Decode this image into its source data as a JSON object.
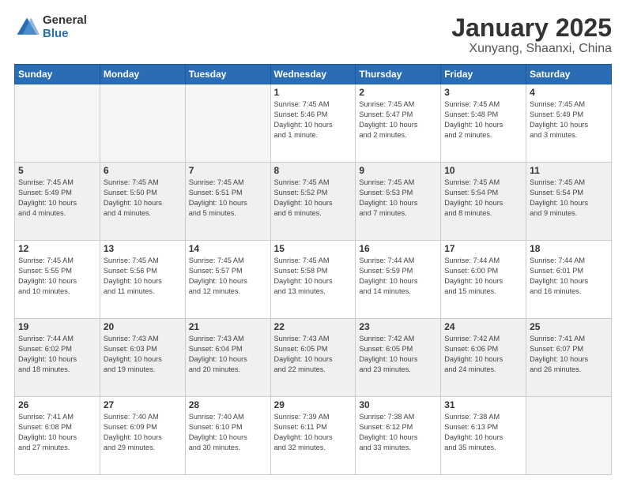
{
  "logo": {
    "general": "General",
    "blue": "Blue"
  },
  "title": "January 2025",
  "subtitle": "Xunyang, Shaanxi, China",
  "weekdays": [
    "Sunday",
    "Monday",
    "Tuesday",
    "Wednesday",
    "Thursday",
    "Friday",
    "Saturday"
  ],
  "weeks": [
    {
      "shaded": false,
      "days": [
        {
          "num": "",
          "info": "",
          "empty": true
        },
        {
          "num": "",
          "info": "",
          "empty": true
        },
        {
          "num": "",
          "info": "",
          "empty": true
        },
        {
          "num": "1",
          "info": "Sunrise: 7:45 AM\nSunset: 5:46 PM\nDaylight: 10 hours\nand 1 minute.",
          "empty": false
        },
        {
          "num": "2",
          "info": "Sunrise: 7:45 AM\nSunset: 5:47 PM\nDaylight: 10 hours\nand 2 minutes.",
          "empty": false
        },
        {
          "num": "3",
          "info": "Sunrise: 7:45 AM\nSunset: 5:48 PM\nDaylight: 10 hours\nand 2 minutes.",
          "empty": false
        },
        {
          "num": "4",
          "info": "Sunrise: 7:45 AM\nSunset: 5:49 PM\nDaylight: 10 hours\nand 3 minutes.",
          "empty": false
        }
      ]
    },
    {
      "shaded": true,
      "days": [
        {
          "num": "5",
          "info": "Sunrise: 7:45 AM\nSunset: 5:49 PM\nDaylight: 10 hours\nand 4 minutes.",
          "empty": false
        },
        {
          "num": "6",
          "info": "Sunrise: 7:45 AM\nSunset: 5:50 PM\nDaylight: 10 hours\nand 4 minutes.",
          "empty": false
        },
        {
          "num": "7",
          "info": "Sunrise: 7:45 AM\nSunset: 5:51 PM\nDaylight: 10 hours\nand 5 minutes.",
          "empty": false
        },
        {
          "num": "8",
          "info": "Sunrise: 7:45 AM\nSunset: 5:52 PM\nDaylight: 10 hours\nand 6 minutes.",
          "empty": false
        },
        {
          "num": "9",
          "info": "Sunrise: 7:45 AM\nSunset: 5:53 PM\nDaylight: 10 hours\nand 7 minutes.",
          "empty": false
        },
        {
          "num": "10",
          "info": "Sunrise: 7:45 AM\nSunset: 5:54 PM\nDaylight: 10 hours\nand 8 minutes.",
          "empty": false
        },
        {
          "num": "11",
          "info": "Sunrise: 7:45 AM\nSunset: 5:54 PM\nDaylight: 10 hours\nand 9 minutes.",
          "empty": false
        }
      ]
    },
    {
      "shaded": false,
      "days": [
        {
          "num": "12",
          "info": "Sunrise: 7:45 AM\nSunset: 5:55 PM\nDaylight: 10 hours\nand 10 minutes.",
          "empty": false
        },
        {
          "num": "13",
          "info": "Sunrise: 7:45 AM\nSunset: 5:56 PM\nDaylight: 10 hours\nand 11 minutes.",
          "empty": false
        },
        {
          "num": "14",
          "info": "Sunrise: 7:45 AM\nSunset: 5:57 PM\nDaylight: 10 hours\nand 12 minutes.",
          "empty": false
        },
        {
          "num": "15",
          "info": "Sunrise: 7:45 AM\nSunset: 5:58 PM\nDaylight: 10 hours\nand 13 minutes.",
          "empty": false
        },
        {
          "num": "16",
          "info": "Sunrise: 7:44 AM\nSunset: 5:59 PM\nDaylight: 10 hours\nand 14 minutes.",
          "empty": false
        },
        {
          "num": "17",
          "info": "Sunrise: 7:44 AM\nSunset: 6:00 PM\nDaylight: 10 hours\nand 15 minutes.",
          "empty": false
        },
        {
          "num": "18",
          "info": "Sunrise: 7:44 AM\nSunset: 6:01 PM\nDaylight: 10 hours\nand 16 minutes.",
          "empty": false
        }
      ]
    },
    {
      "shaded": true,
      "days": [
        {
          "num": "19",
          "info": "Sunrise: 7:44 AM\nSunset: 6:02 PM\nDaylight: 10 hours\nand 18 minutes.",
          "empty": false
        },
        {
          "num": "20",
          "info": "Sunrise: 7:43 AM\nSunset: 6:03 PM\nDaylight: 10 hours\nand 19 minutes.",
          "empty": false
        },
        {
          "num": "21",
          "info": "Sunrise: 7:43 AM\nSunset: 6:04 PM\nDaylight: 10 hours\nand 20 minutes.",
          "empty": false
        },
        {
          "num": "22",
          "info": "Sunrise: 7:43 AM\nSunset: 6:05 PM\nDaylight: 10 hours\nand 22 minutes.",
          "empty": false
        },
        {
          "num": "23",
          "info": "Sunrise: 7:42 AM\nSunset: 6:05 PM\nDaylight: 10 hours\nand 23 minutes.",
          "empty": false
        },
        {
          "num": "24",
          "info": "Sunrise: 7:42 AM\nSunset: 6:06 PM\nDaylight: 10 hours\nand 24 minutes.",
          "empty": false
        },
        {
          "num": "25",
          "info": "Sunrise: 7:41 AM\nSunset: 6:07 PM\nDaylight: 10 hours\nand 26 minutes.",
          "empty": false
        }
      ]
    },
    {
      "shaded": false,
      "days": [
        {
          "num": "26",
          "info": "Sunrise: 7:41 AM\nSunset: 6:08 PM\nDaylight: 10 hours\nand 27 minutes.",
          "empty": false
        },
        {
          "num": "27",
          "info": "Sunrise: 7:40 AM\nSunset: 6:09 PM\nDaylight: 10 hours\nand 29 minutes.",
          "empty": false
        },
        {
          "num": "28",
          "info": "Sunrise: 7:40 AM\nSunset: 6:10 PM\nDaylight: 10 hours\nand 30 minutes.",
          "empty": false
        },
        {
          "num": "29",
          "info": "Sunrise: 7:39 AM\nSunset: 6:11 PM\nDaylight: 10 hours\nand 32 minutes.",
          "empty": false
        },
        {
          "num": "30",
          "info": "Sunrise: 7:38 AM\nSunset: 6:12 PM\nDaylight: 10 hours\nand 33 minutes.",
          "empty": false
        },
        {
          "num": "31",
          "info": "Sunrise: 7:38 AM\nSunset: 6:13 PM\nDaylight: 10 hours\nand 35 minutes.",
          "empty": false
        },
        {
          "num": "",
          "info": "",
          "empty": true
        }
      ]
    }
  ]
}
